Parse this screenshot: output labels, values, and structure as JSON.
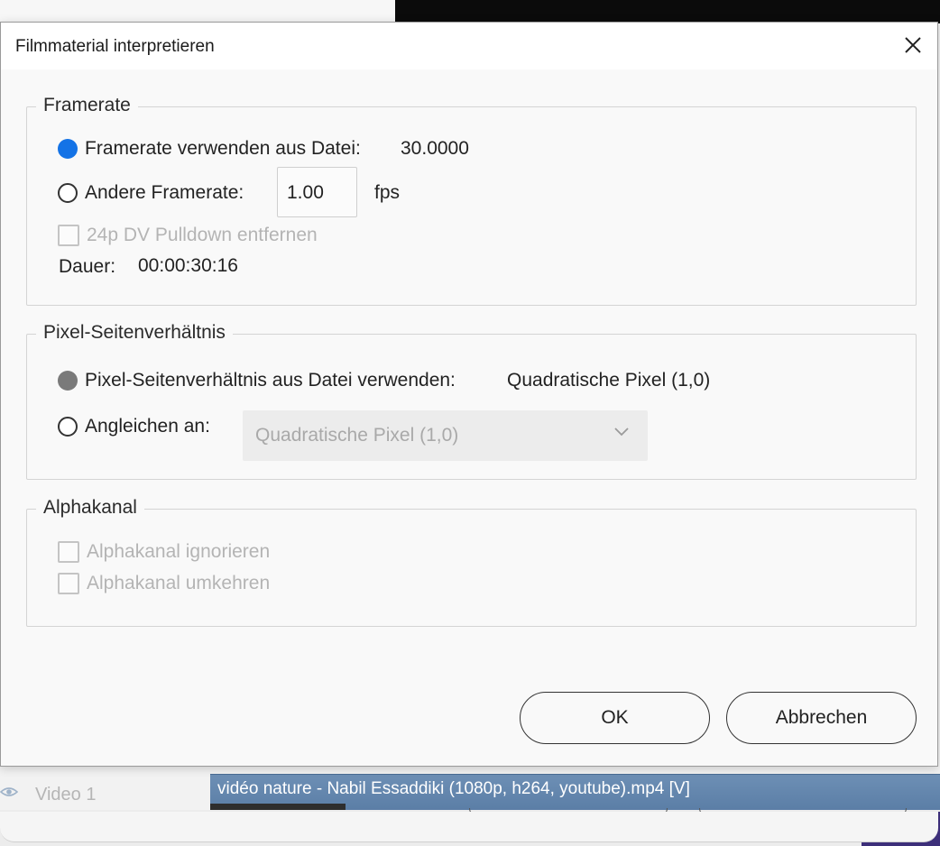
{
  "dialog": {
    "title": "Filmmaterial interpretieren"
  },
  "framerate": {
    "legend": "Framerate",
    "use_file_label": "Framerate verwenden aus Datei:",
    "file_value": "30.0000",
    "other_label": "Andere Framerate:",
    "other_value": "1.00",
    "fps_unit": "fps",
    "pulldown_label": "24p DV Pulldown entfernen",
    "duration_label": "Dauer:",
    "duration_value": "00:00:30:16"
  },
  "pixel_aspect": {
    "legend": "Pixel-Seitenverhältnis",
    "use_file_label": "Pixel-Seitenverhältnis aus Datei verwenden:",
    "file_value": "Quadratische Pixel (1,0)",
    "conform_label": "Angleichen an:",
    "conform_value": "Quadratische Pixel (1,0)"
  },
  "alpha": {
    "legend": "Alphakanal",
    "ignore_label": "Alphakanal ignorieren",
    "invert_label": "Alphakanal umkehren"
  },
  "buttons": {
    "ok": "OK",
    "cancel": "Abbrechen"
  },
  "background": {
    "track_label": "Video 1",
    "clip_label": "vidéo nature - Nabil Essaddiki (1080p, h264, youtube).mp4 [V]"
  },
  "colors": {
    "accent": "#1473e6",
    "clip": "#5b7ea6"
  }
}
